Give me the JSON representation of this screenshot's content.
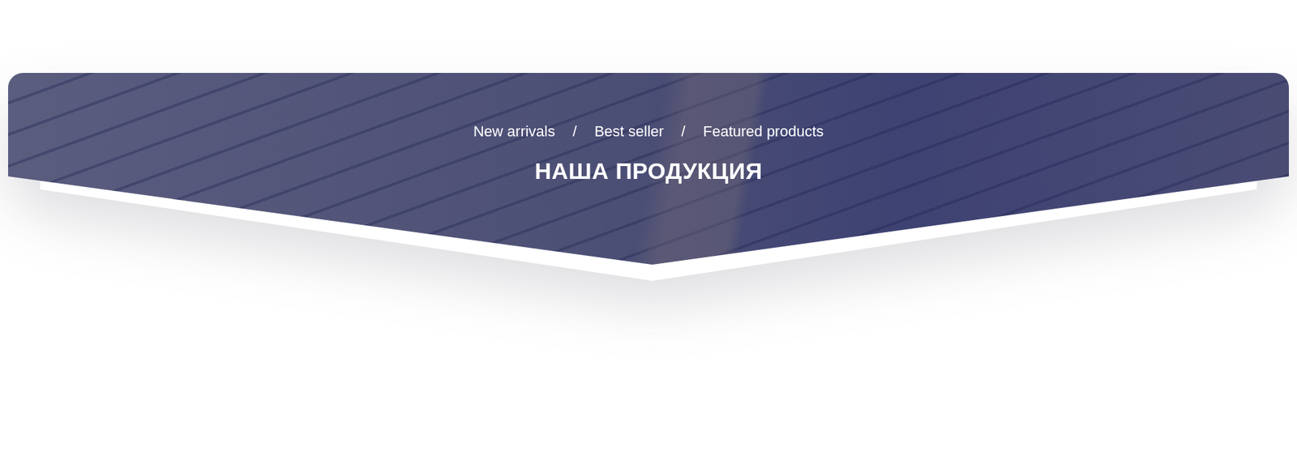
{
  "banner": {
    "nav": [
      {
        "label": "New arrivals"
      },
      {
        "label": "Best seller"
      },
      {
        "label": "Featured products"
      }
    ],
    "separator": "/",
    "title": "НАША ПРОДУКЦИЯ"
  }
}
